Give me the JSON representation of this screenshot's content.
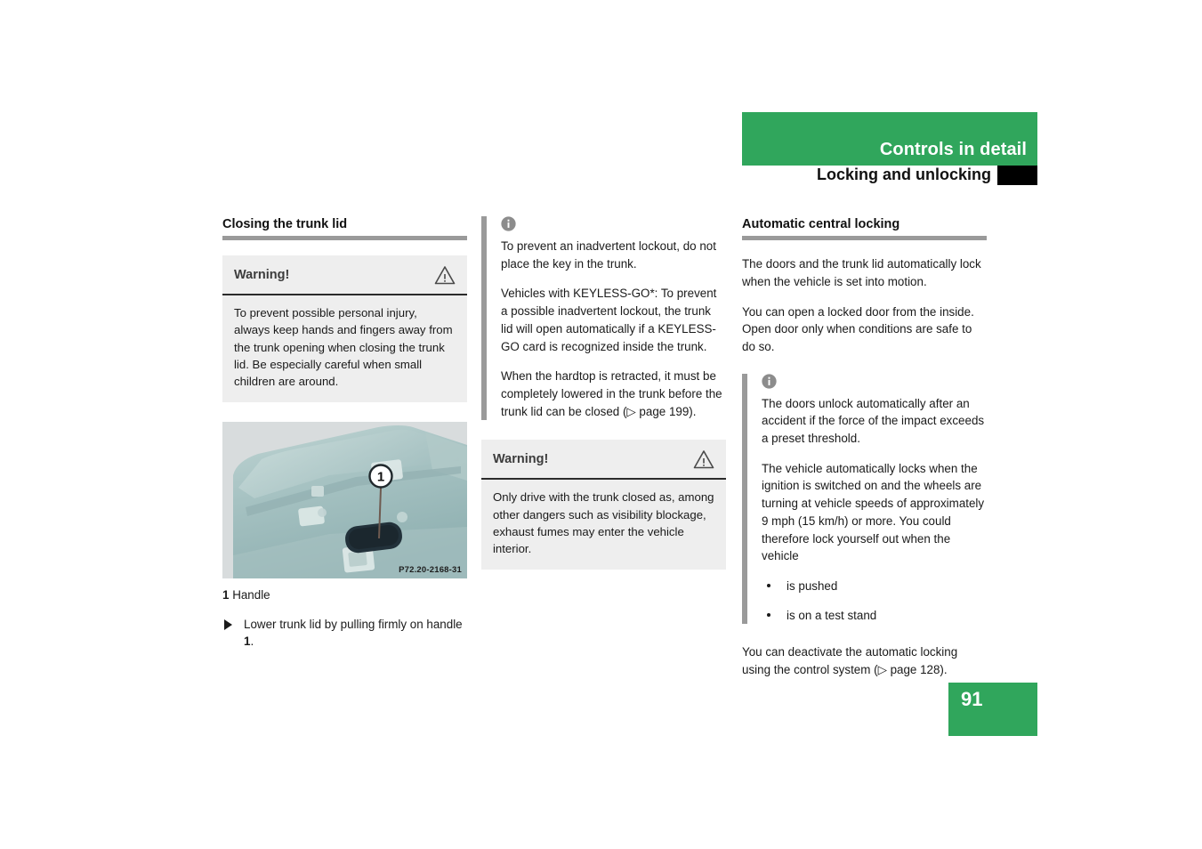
{
  "header": {
    "chapter_title": "Controls in detail",
    "section_title": "Locking and unlocking",
    "green": "#30a65c"
  },
  "page_number": "91",
  "left_column": {
    "heading": "Closing the trunk lid",
    "warning": {
      "title": "Warning!",
      "icon": "warning-triangle-icon",
      "body": "To prevent possible personal injury, always keep hands and fingers away from the trunk opening when closing the trunk lid. Be especially careful when small children are around."
    },
    "figure": {
      "code": "P72.20-2168-31",
      "callout": "1",
      "alt": "Trunk lid interior with handle"
    },
    "legend_number": "1",
    "legend_label": "Handle",
    "step": {
      "text_before": "Lower trunk lid by pulling firmly on handle ",
      "bold_ref": "1",
      "text_after": "."
    }
  },
  "middle_column": {
    "note": {
      "icon": "info-circle-icon",
      "paragraphs": [
        "To prevent an inadvertent lockout, do not place the key in the trunk.",
        "Vehicles with KEYLESS-GO*: To prevent a possible inadvertent lockout, the trunk lid will open automatically if a KEYLESS-GO card is recognized inside the trunk.",
        "When the hardtop is retracted, it must be completely lowered in the trunk before the trunk lid can be closed (▷ page 199)."
      ]
    },
    "warning": {
      "title": "Warning!",
      "icon": "warning-triangle-icon",
      "body": "Only drive with the trunk closed as, among other dangers such as visibility blockage, exhaust fumes may enter the vehicle interior."
    }
  },
  "right_column": {
    "heading": "Automatic central locking",
    "paragraphs": [
      "The doors and the trunk lid automatically lock when the vehicle is set into motion.",
      "You can open a locked door from the inside. Open door only when conditions are safe to do so."
    ],
    "note": {
      "icon": "info-circle-icon",
      "paragraphs": [
        "The doors unlock automatically after an accident if the force of the impact exceeds a preset threshold.",
        "The vehicle automatically locks when the ignition is switched on and the wheels are turning at vehicle speeds of approximately 9 mph (15 km/h) or more. You could therefore lock yourself out when the vehicle"
      ],
      "bullets": [
        "is pushed",
        "is on a test stand"
      ]
    },
    "closing_paragraph": "You can deactivate the automatic locking using the control system (▷ page 128)."
  }
}
